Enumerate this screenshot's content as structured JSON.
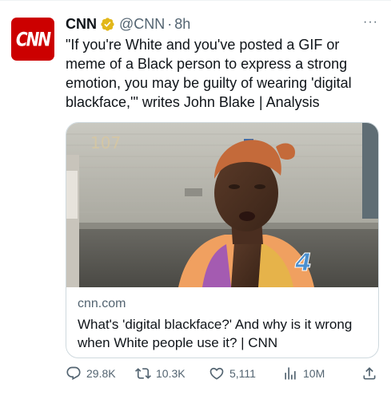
{
  "author": {
    "avatar_text": "CNN",
    "name": "CNN",
    "handle": "@CNN",
    "separator": "·",
    "time": "8h"
  },
  "tweet": {
    "text": "\"If you're White and you've posted a GIF or meme of a Black person to express a strong emotion, you may be guilty of wearing 'digital blackface,'\" writes John Blake | Analysis"
  },
  "card": {
    "domain": "cnn.com",
    "title": "What's 'digital blackface?' And why is it wrong when White people use it? | CNN",
    "image_icon": "news-photo",
    "image_overlay_text": "107",
    "image_logo_text": "4"
  },
  "actions": {
    "replies": "29.8K",
    "retweets": "10.3K",
    "likes": "5,111",
    "views": "10M"
  },
  "colors": {
    "brand": "#cc0000",
    "text": "#0f1419",
    "secondary": "#536471",
    "verified": "#e2b719",
    "border": "#cfd9de"
  },
  "icons": [
    "verified-badge-icon",
    "more-icon",
    "reply-icon",
    "retweet-icon",
    "like-icon",
    "views-icon",
    "share-icon"
  ]
}
